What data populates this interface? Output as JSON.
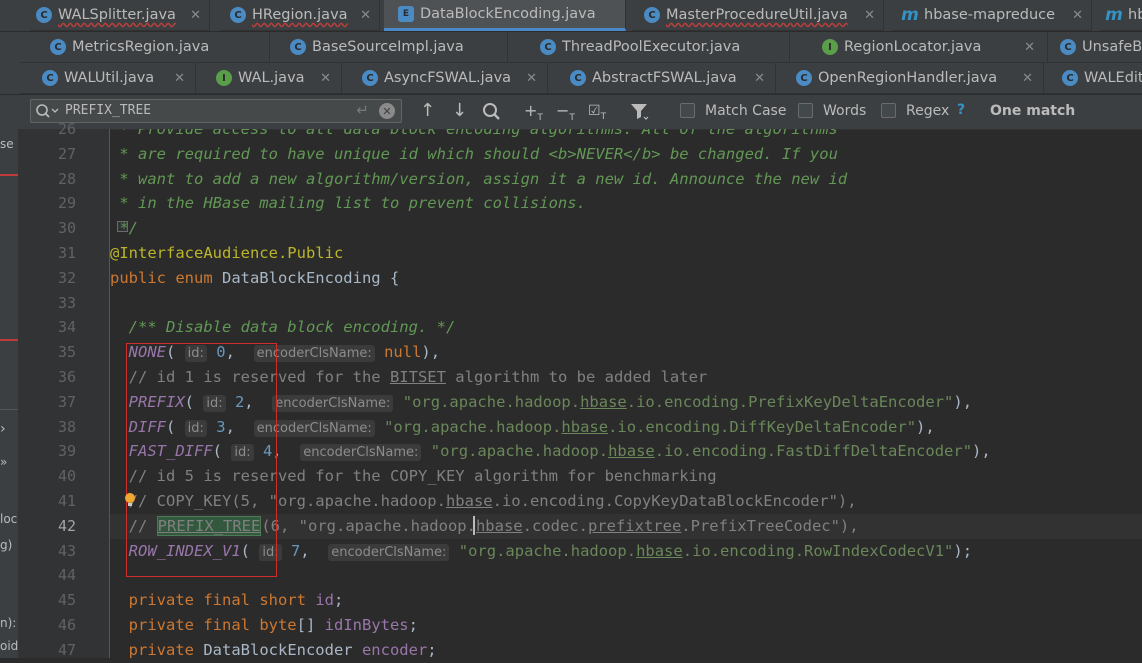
{
  "tabs": {
    "row1": [
      {
        "name": "WALSplitter.java",
        "icon": "C",
        "error": true
      },
      {
        "name": "HRegion.java",
        "icon": "C",
        "error": true
      },
      {
        "name": "DataBlockEncoding.java",
        "icon": "E",
        "error": false,
        "active": true
      },
      {
        "name": "MasterProcedureUtil.java",
        "icon": "C",
        "error": true
      },
      {
        "name": "hbase-mapreduce",
        "icon": "m",
        "error": false
      },
      {
        "name": "hb",
        "icon": "m",
        "error": false
      }
    ],
    "row2": [
      {
        "name": "MetricsRegion.java",
        "icon": "C"
      },
      {
        "name": "BaseSourceImpl.java",
        "icon": "C"
      },
      {
        "name": "ThreadPoolExecutor.java",
        "icon": "C"
      },
      {
        "name": "RegionLocator.java",
        "icon": "I"
      },
      {
        "name": "UnsafeB",
        "icon": "C"
      }
    ],
    "row3": [
      {
        "name": "WALUtil.java",
        "icon": "C"
      },
      {
        "name": "WAL.java",
        "icon": "I"
      },
      {
        "name": "AsyncFSWAL.java",
        "icon": "C"
      },
      {
        "name": "AbstractFSWAL.java",
        "icon": "C"
      },
      {
        "name": "OpenRegionHandler.java",
        "icon": "C"
      },
      {
        "name": "WALEdit",
        "icon": "C"
      }
    ]
  },
  "find": {
    "query": "PREFIX_TREE",
    "match_case": "Match Case",
    "words": "Words",
    "regex": "Regex",
    "help": "?",
    "result": "One match"
  },
  "left_panel": [
    "se",
    "›",
    "»",
    "loc",
    "g)",
    "n):",
    "oid"
  ],
  "lines": [
    {
      "n": "26",
      "html": "<span class='cm'> * Provide access to all data block encoding algorithms. All of the algorithms</span>"
    },
    {
      "n": "27",
      "html": "<span class='cm'> * are required to have unique id which should </span><span class='tag'>&lt;b&gt;</span><span class='cm'>NEVER</span><span class='tag'>&lt;/b&gt;</span><span class='cm'> be changed. If you</span>"
    },
    {
      "n": "28",
      "html": "<span class='cm'> * want to add a new algorithm/version, assign it a new id. Announce the new id</span>"
    },
    {
      "n": "29",
      "html": "<span class='cm'> * in the HBase mailing list to prevent collisions.</span>"
    },
    {
      "n": "30",
      "html": "<span class='cm'> */</span>"
    },
    {
      "n": "31",
      "html": "<span class='ann'>@InterfaceAudience.Public</span>"
    },
    {
      "n": "32",
      "html": "<span class='kw'>public enum </span>DataBlockEncoding {"
    },
    {
      "n": "33",
      "html": ""
    },
    {
      "n": "34",
      "html": "  <span class='cm'>/** Disable data block encoding. */</span>"
    },
    {
      "n": "35",
      "html": "  <span class='enumc'>NONE</span>( <span class='hint'>id:</span> <span class='num'>0</span>,  <span class='hint'>encoderClsName:</span> <span class='kw'>null</span>),"
    },
    {
      "n": "36",
      "html": "  <span class='cmt'>// id 1 is reserved for the <span style='text-decoration:underline'>BITSET</span> algorithm to be added later</span>"
    },
    {
      "n": "37",
      "html": "  <span class='enumc'>PREFIX</span>( <span class='hint'>id:</span> <span class='num'>2</span>,  <span class='hint'>encoderClsName:</span> <span class='str'>\"org.apache.hadoop.<span class='ul'>hbase</span>.io.encoding.PrefixKeyDeltaEncoder\"</span>),"
    },
    {
      "n": "38",
      "html": "  <span class='enumc'>DIFF</span>( <span class='hint'>id:</span> <span class='num'>3</span>,  <span class='hint'>encoderClsName:</span> <span class='str'>\"org.apache.hadoop.<span class='ul'>hbase</span>.io.encoding.DiffKeyDeltaEncoder\"</span>),"
    },
    {
      "n": "39",
      "html": "  <span class='enumc'>FAST_DIFF</span>( <span class='hint'>id:</span> <span class='num'>4</span>,  <span class='hint'>encoderClsName:</span> <span class='str'>\"org.apache.hadoop.<span class='ul'>hbase</span>.io.encoding.FastDiffDeltaEncoder\"</span>),"
    },
    {
      "n": "40",
      "html": "  <span class='cmt'>// id 5 is reserved for the COPY_KEY algorithm for benchmarking</span>"
    },
    {
      "n": "41",
      "html": "  <span class='cmt'>// COPY_KEY(5, \"org.apache.hadoop.<span style='text-decoration:underline'>hbase</span>.io.encoding.CopyKeyDataBlockEncoder\"),</span>"
    },
    {
      "n": "42",
      "html": "  <span class='cmt'>// <span class='hl' style='text-decoration:underline'>PREFIX_TREE</span>(6, \"org.apache.hadoop.<span style='text-decoration:underline'>hbase</span>.codec.<span style='text-decoration:underline'>prefixtree</span>.PrefixTreeCodec\"),</span>",
      "current": true
    },
    {
      "n": "43",
      "html": "  <span class='enumc'>ROW_INDEX_V1</span>( <span class='hint'>id:</span> <span class='num'>7</span>,  <span class='hint'>encoderClsName:</span> <span class='str'>\"org.apache.hadoop.<span class='ul'>hbase</span>.io.encoding.RowIndexCodecV1\"</span>);"
    },
    {
      "n": "44",
      "html": ""
    },
    {
      "n": "45",
      "html": "  <span class='kw'>private final short </span><span class='enumc' style='font-style:normal'>id</span>;"
    },
    {
      "n": "46",
      "html": "  <span class='kw'>private final byte</span>[] <span class='enumc' style='font-style:normal'>idInBytes</span>;"
    },
    {
      "n": "47",
      "html": "  <span class='kw'>private </span>DataBlockEncoder <span class='enumc' style='font-style:normal'>encoder</span>;"
    }
  ]
}
